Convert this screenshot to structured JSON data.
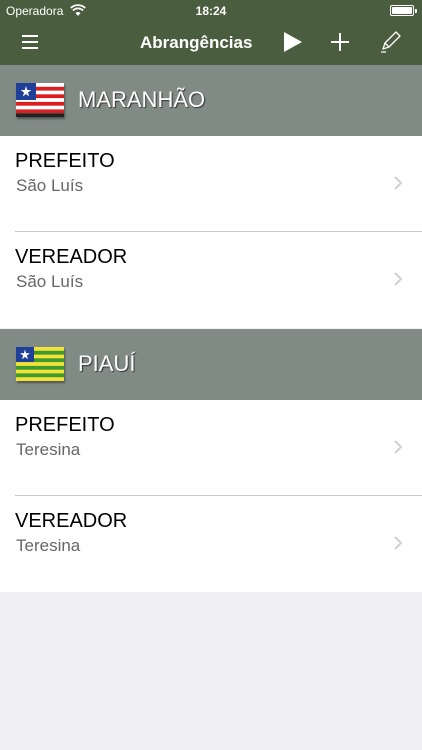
{
  "status_bar": {
    "carrier": "Operadora",
    "time": "18:24"
  },
  "nav": {
    "title": "Abrangências",
    "menu_icon": "hamburger-menu-icon",
    "play_icon": "play-icon",
    "add_icon": "plus-icon",
    "edit_icon": "pencil-icon"
  },
  "colors": {
    "nav_bg": "#4a5e3f",
    "section_bg": "#808b86",
    "list_bg": "#ffffff",
    "page_bg": "#efeff4"
  },
  "sections": [
    {
      "state": "MARANHÃO",
      "flag_icon": "maranhao-flag-icon",
      "rows": [
        {
          "title": "PREFEITO",
          "subtitle": "São Luís"
        },
        {
          "title": "VEREADOR",
          "subtitle": "São Luís"
        }
      ]
    },
    {
      "state": "PIAUÍ",
      "flag_icon": "piaui-flag-icon",
      "rows": [
        {
          "title": "PREFEITO",
          "subtitle": "Teresina"
        },
        {
          "title": "VEREADOR",
          "subtitle": "Teresina"
        }
      ]
    }
  ]
}
